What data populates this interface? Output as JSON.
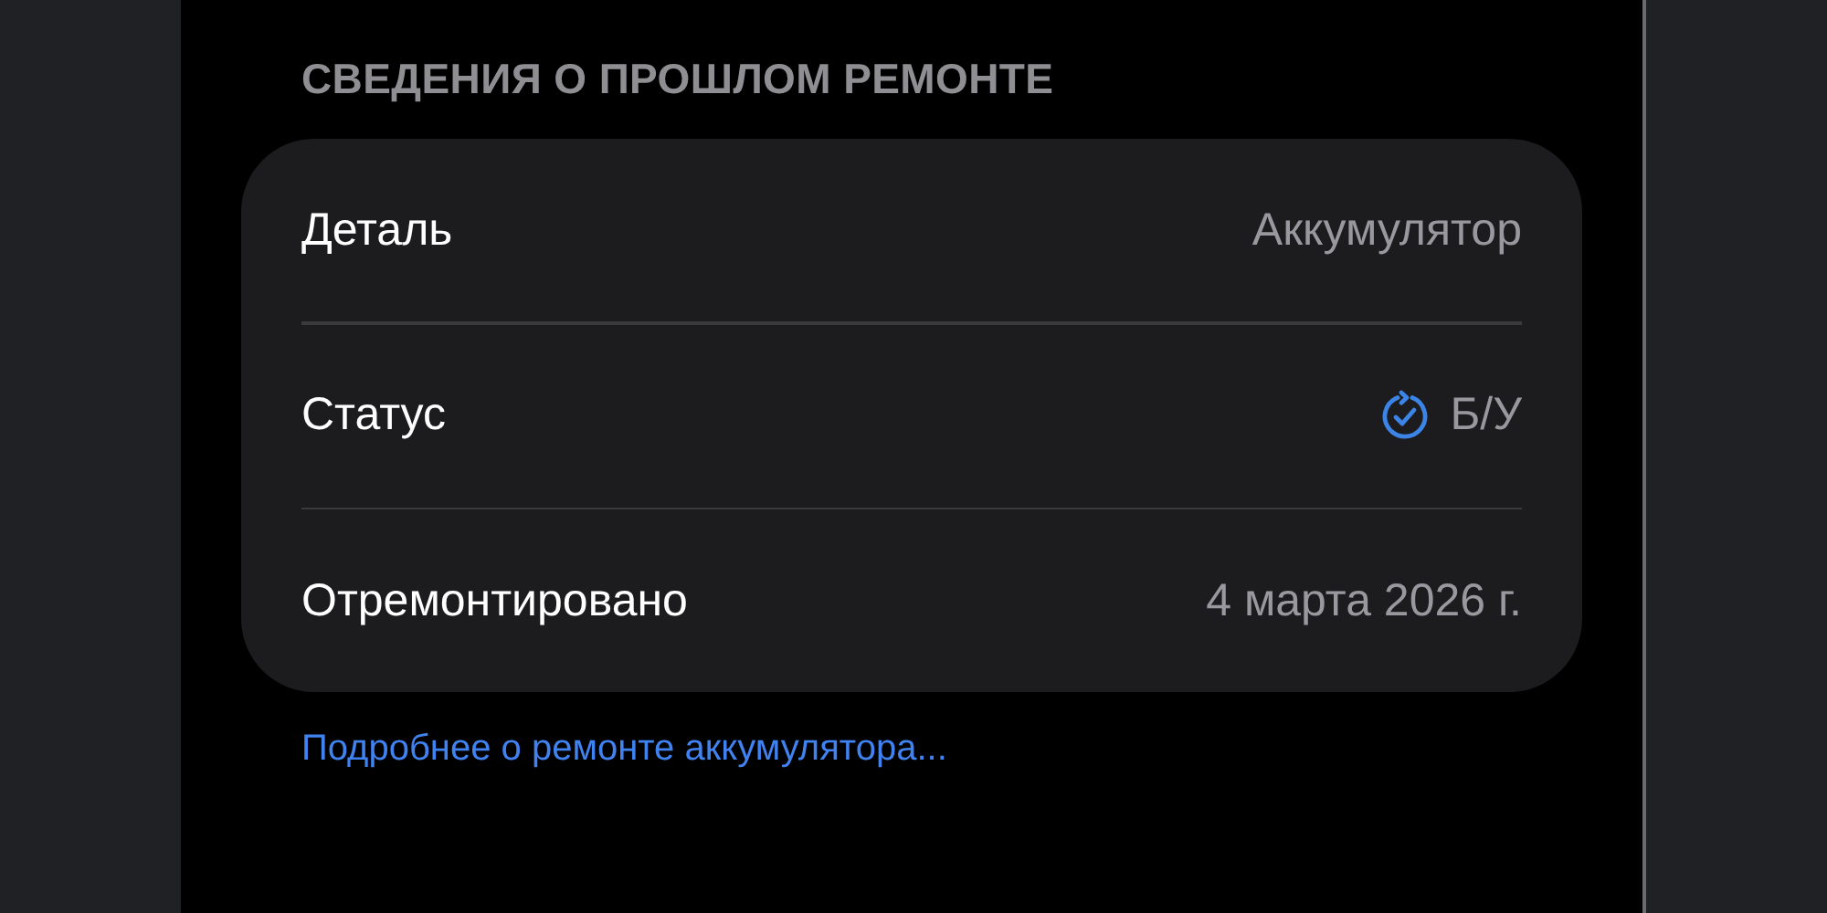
{
  "section": {
    "title": "СВЕДЕНИЯ О ПРОШЛОМ РЕМОНТЕ",
    "rows": [
      {
        "label": "Деталь",
        "value": "Аккумулятор",
        "kind": "text"
      },
      {
        "label": "Статус",
        "value": "Б/У",
        "kind": "status"
      },
      {
        "label": "Отремонтировано",
        "value": "4 марта 2026 г.",
        "kind": "text"
      }
    ],
    "link": "Подробнее о ремонте аккумулятора..."
  }
}
